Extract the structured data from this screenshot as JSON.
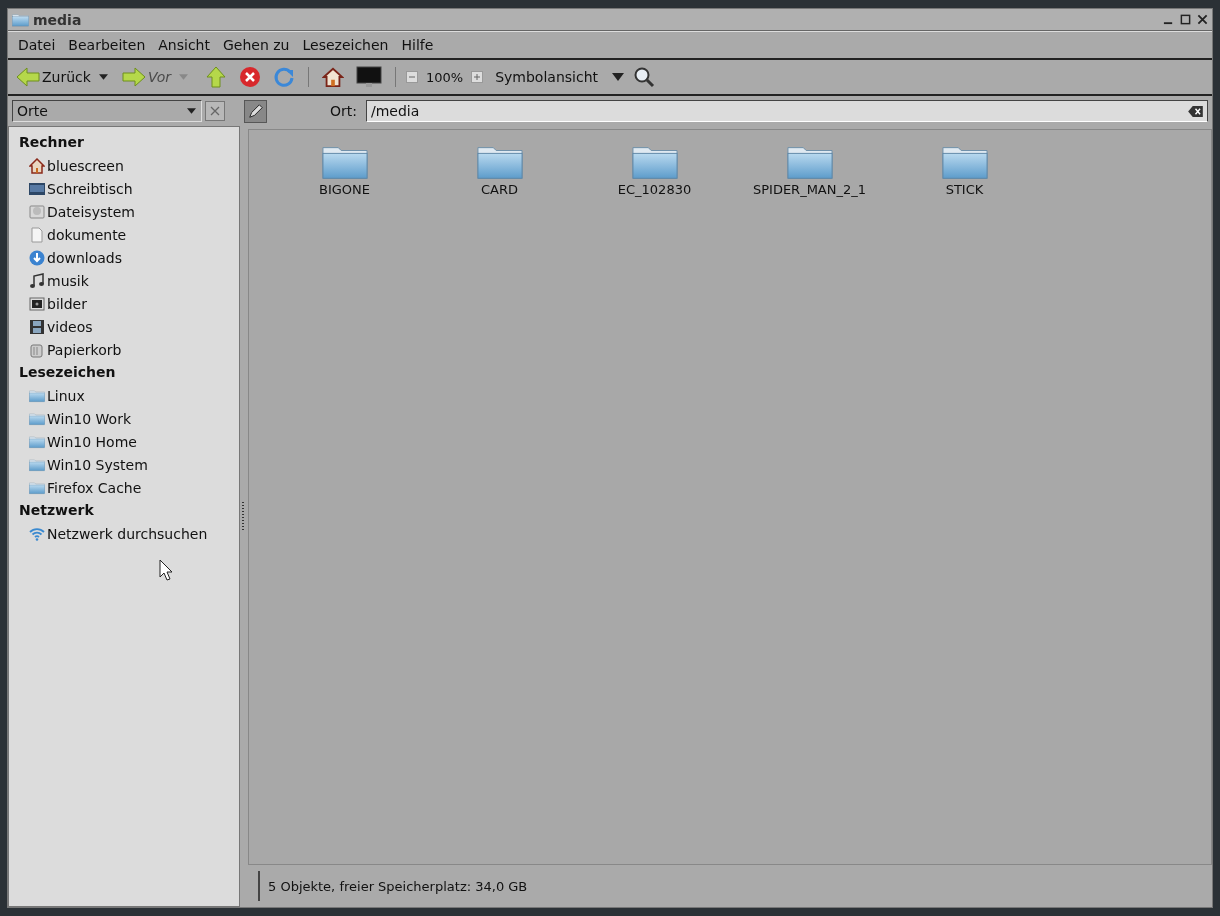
{
  "window": {
    "title": "media"
  },
  "menu": [
    "Datei",
    "Bearbeiten",
    "Ansicht",
    "Gehen zu",
    "Lesezeichen",
    "Hilfe"
  ],
  "toolbar": {
    "back": {
      "label": "Zurück",
      "disabled": false
    },
    "forward": {
      "label": "Vor",
      "disabled": true
    },
    "zoom": "100%",
    "view": "Symbolansicht"
  },
  "sidebar": {
    "selector": "Orte",
    "sections": [
      {
        "title": "Rechner",
        "items": [
          {
            "label": "bluescreen",
            "kind": "home"
          },
          {
            "label": "Schreibtisch",
            "kind": "desktop"
          },
          {
            "label": "Dateisystem",
            "kind": "drive"
          },
          {
            "label": "dokumente",
            "kind": "document"
          },
          {
            "label": "downloads",
            "kind": "download"
          },
          {
            "label": "musik",
            "kind": "music"
          },
          {
            "label": "bilder",
            "kind": "pictures"
          },
          {
            "label": "videos",
            "kind": "video"
          },
          {
            "label": "Papierkorb",
            "kind": "trash"
          }
        ]
      },
      {
        "title": "Lesezeichen",
        "items": [
          {
            "label": "Linux",
            "kind": "folder"
          },
          {
            "label": "Win10 Work",
            "kind": "folder"
          },
          {
            "label": "Win10 Home",
            "kind": "folder"
          },
          {
            "label": "Win10 System",
            "kind": "folder"
          },
          {
            "label": "Firefox Cache",
            "kind": "folder"
          }
        ]
      },
      {
        "title": "Netzwerk",
        "items": [
          {
            "label": "Netzwerk durchsuchen",
            "kind": "network"
          }
        ]
      }
    ]
  },
  "location": {
    "label": "Ort:",
    "value": "/media"
  },
  "files": [
    "BIGONE",
    "CARD",
    "EC_102830",
    "SPIDER_MAN_2_1",
    "STICK"
  ],
  "status_bar": "5 Objekte, freier Speicherplatz: 34,0 GB"
}
